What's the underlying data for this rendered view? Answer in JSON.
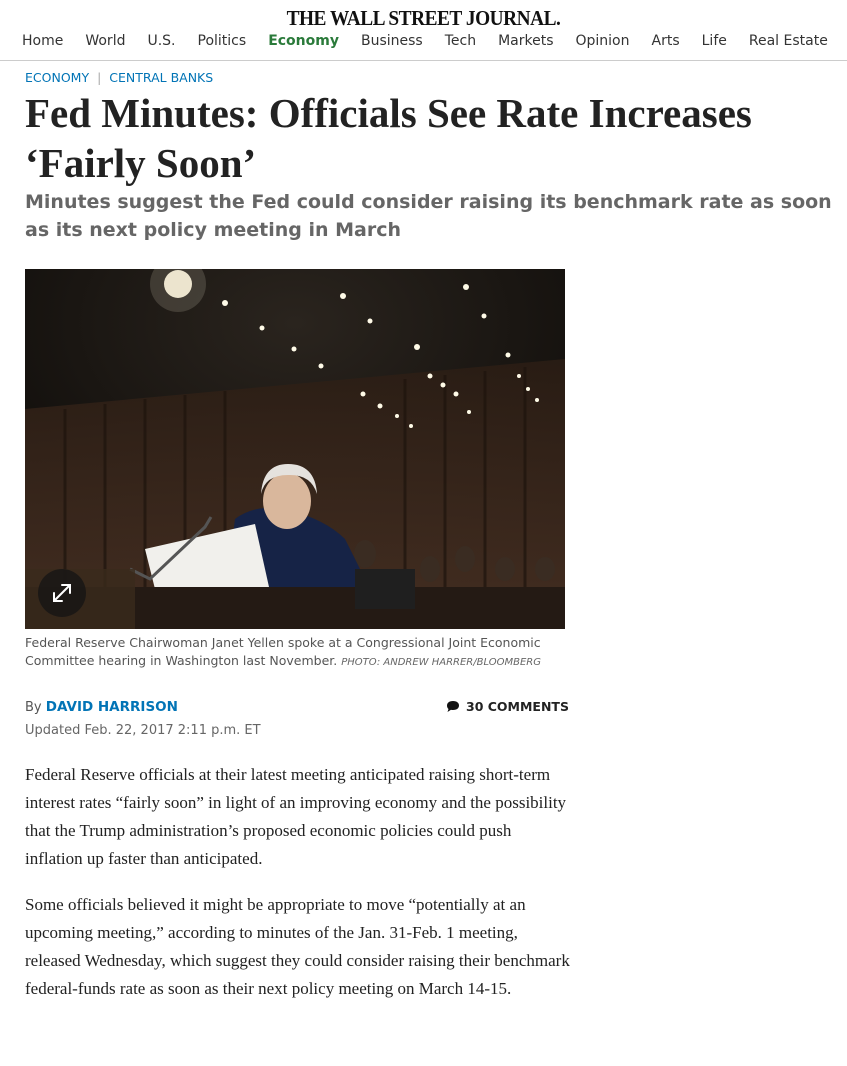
{
  "masthead": "THE WALL STREET JOURNAL.",
  "nav": {
    "items": [
      {
        "label": "Home",
        "active": false
      },
      {
        "label": "World",
        "active": false
      },
      {
        "label": "U.S.",
        "active": false
      },
      {
        "label": "Politics",
        "active": false
      },
      {
        "label": "Economy",
        "active": true
      },
      {
        "label": "Business",
        "active": false
      },
      {
        "label": "Tech",
        "active": false
      },
      {
        "label": "Markets",
        "active": false
      },
      {
        "label": "Opinion",
        "active": false
      },
      {
        "label": "Arts",
        "active": false
      },
      {
        "label": "Life",
        "active": false
      },
      {
        "label": "Real Estate",
        "active": false
      }
    ],
    "active_color": "#2a7a3a"
  },
  "kicker": {
    "section": "ECONOMY",
    "separator": "|",
    "subsection": "CENTRAL BANKS",
    "color": "#0274b6"
  },
  "article": {
    "headline": "Fed Minutes: Officials See Rate Increases ‘Fairly Soon’",
    "dek": "Minutes suggest the Fed could consider raising its benchmark rate as soon as its next policy meeting in March",
    "photo": {
      "expand_icon": "expand-icon",
      "caption": "Federal Reserve Chairwoman Janet Yellen spoke at a Congressional Joint Economic Committee hearing in Washington last November.",
      "credit": "PHOTO: ANDREW HARRER/BLOOMBERG"
    },
    "byline_prefix": "By",
    "author": "DAVID HARRISON",
    "comments": {
      "icon": "comment-bubble-icon",
      "label": "30 COMMENTS"
    },
    "updated": "Updated Feb. 22, 2017 2:11 p.m. ET",
    "paragraphs": [
      "Federal Reserve officials at their latest meeting anticipated raising short-term interest rates “fairly soon” in light of an improving economy and the possibility that the Trump administration’s proposed economic policies could push inflation up faster than anticipated.",
      "Some officials believed it might be appropriate to move “potentially at an upcoming meeting,” according to minutes of the Jan. 31-Feb. 1 meeting, released Wednesday, which suggest they could consider raising their benchmark federal-funds rate as soon as their next policy meeting on March 14-15."
    ]
  }
}
